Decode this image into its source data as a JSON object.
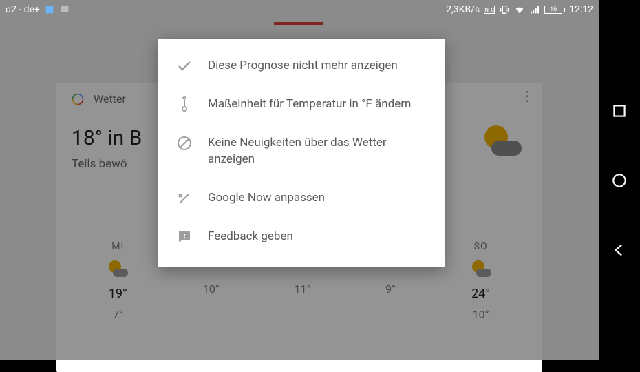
{
  "status": {
    "carrier": "o2 - de+",
    "speed": "2,3KB/s",
    "nfc": "NFC",
    "battery": "16",
    "time": "12:12"
  },
  "card": {
    "title": "Wetter",
    "temp_line": "18° in B",
    "desc": "Teils bewö"
  },
  "forecast": [
    {
      "day": "MI",
      "high": "19°",
      "low": "7°"
    },
    {
      "day": "",
      "high": "",
      "low": "10°"
    },
    {
      "day": "",
      "high": "",
      "low": "11°"
    },
    {
      "day": "",
      "high": "",
      "low": "9°"
    },
    {
      "day": "SO",
      "high": "24°",
      "low": "10°"
    }
  ],
  "menu": {
    "hide_forecast": "Diese Prognose nicht mehr anzeigen",
    "change_unit": "Maßeinheit für Temperatur in °F ändern",
    "no_news": "Keine Neuigkeiten über das Wetter anzeigen",
    "customize": "Google Now anpassen",
    "feedback": "Feedback geben"
  }
}
